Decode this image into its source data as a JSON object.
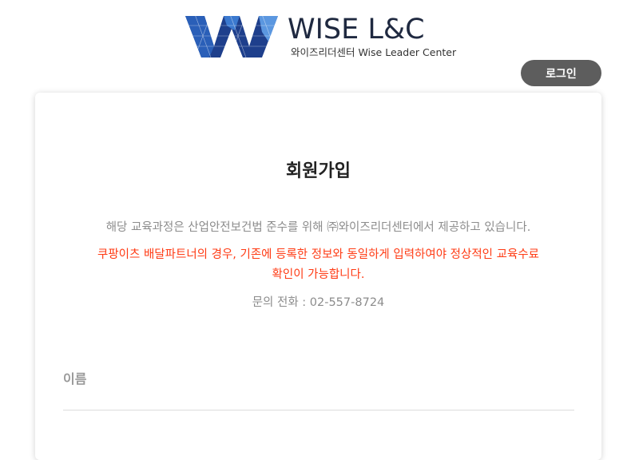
{
  "header": {
    "brand": "WISE L&C",
    "brand_sub": "와이즈리더센터 Wise Leader Center",
    "login_label": "로그인"
  },
  "colors": {
    "logo_blue_dark": "#1e3f8c",
    "logo_blue_light": "#4a86d8",
    "warning": "#ff3b14",
    "button": "#5d5d5d"
  },
  "form": {
    "title": "회원가입",
    "notice": "해당 교육과정은 산업안전보건법 준수를 위해 ㈜와이즈리더센터에서 제공하고 있습니다.",
    "warning_line1": "쿠팡이츠 배달파트너의 경우, 기존에 등록한 정보와 동일하게 입력하여야 정상적인 교육수료",
    "warning_line2": "확인이 가능합니다.",
    "phone": "문의 전화 : 02-557-8724",
    "name_label": "이름",
    "name_value": ""
  }
}
